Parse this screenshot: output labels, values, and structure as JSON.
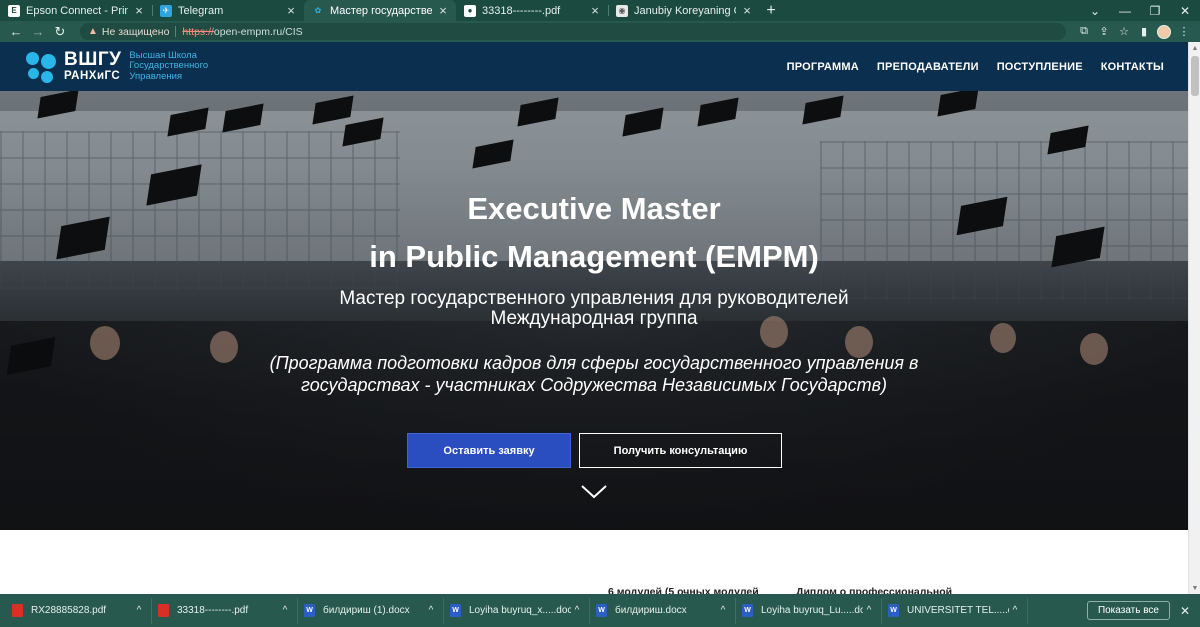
{
  "browser": {
    "tabs": [
      {
        "title": "Epson Connect - Print and Scan F",
        "favicon": "E",
        "favicon_color": "#ffffff",
        "favicon_text_color": "#1a4a40",
        "active": false
      },
      {
        "title": "Telegram",
        "favicon": "✈",
        "favicon_color": "#2ca5e0",
        "favicon_text_color": "#ffffff",
        "active": false
      },
      {
        "title": "Мастер государственного упра",
        "favicon": "✿",
        "favicon_color": "#27594e",
        "favicon_text_color": "#29b6e8",
        "active": true
      },
      {
        "title": "33318--------.pdf",
        "favicon": "●",
        "favicon_color": "#ffffff",
        "favicon_text_color": "#1a4a40",
        "active": false
      },
      {
        "title": "Janubiy Koreyaning Chonnam Mi",
        "favicon": "◉",
        "favicon_color": "#e8e8e8",
        "favicon_text_color": "#555555",
        "active": false
      }
    ],
    "new_tab_label": "+",
    "insecure_label": "Не защищено",
    "url_scheme": "https://",
    "url_rest": "open-empm.ru/CIS"
  },
  "site": {
    "logo_abbr_line1": "ВШГУ",
    "logo_abbr_line2": "РАНХиГС",
    "logo_text": [
      "Высшая Школа",
      "Государственного",
      "Управления"
    ],
    "nav": [
      "ПРОГРАММА",
      "ПРЕПОДАВАТЕЛИ",
      "ПОСТУПЛЕНИЕ",
      "КОНТАКТЫ"
    ]
  },
  "hero": {
    "title_line1": "Executive Master",
    "title_line2": "in Public Management (EMPM)",
    "subtitle_line1": "Мастер государственного управления для руководителей",
    "subtitle_line2": "Международная группа",
    "note_line1": "(Программа подготовки кадров для сферы государственного управления в",
    "note_line2": "государствах - участниках Содружества Независимых Государств)",
    "primary_button": "Оставить заявку",
    "secondary_button": "Получить консультацию"
  },
  "below": {
    "peek_left": "6 модулей (5 очных модулей",
    "peek_right": "Диплом о профессиональной"
  },
  "downloads": {
    "items": [
      {
        "name": "RX28885828.pdf",
        "type": "pdf"
      },
      {
        "name": "33318--------.pdf",
        "type": "pdf"
      },
      {
        "name": "билдириш (1).docx",
        "type": "doc"
      },
      {
        "name": "Loyiha buyruq_x.....docx",
        "type": "doc"
      },
      {
        "name": "билдириш.docx",
        "type": "doc"
      },
      {
        "name": "Loyiha buyruq_Lu.....docx",
        "type": "doc"
      },
      {
        "name": "UNIVERSITET TEL.....docx",
        "type": "doc"
      }
    ],
    "show_all": "Показать все"
  },
  "colors": {
    "browser_frame": "#27594e",
    "site_header": "#0a2f4f",
    "logo_accent": "#29b6e8",
    "primary_button": "#2a4ec0"
  }
}
